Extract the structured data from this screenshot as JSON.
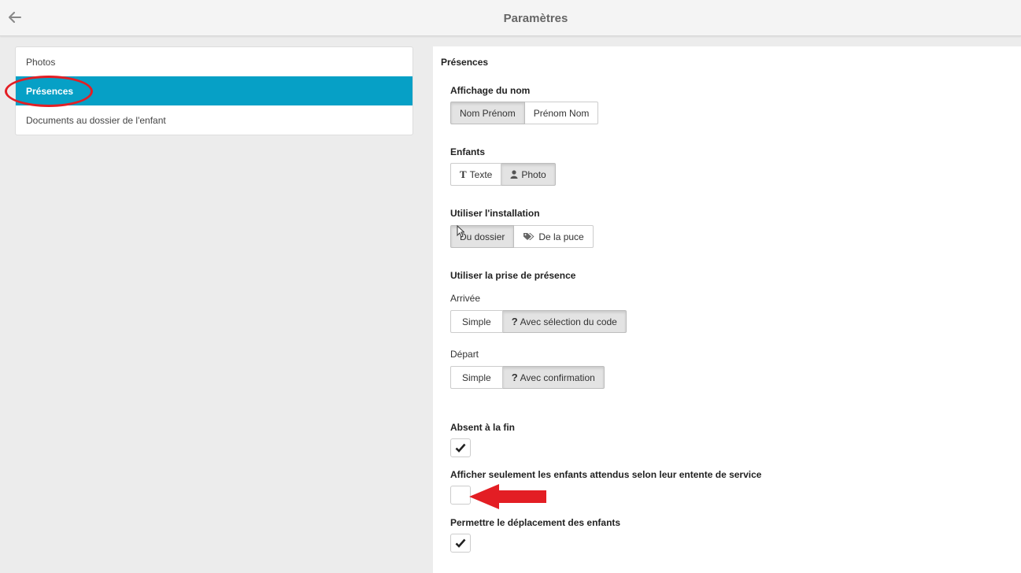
{
  "header": {
    "title": "Paramètres",
    "back_icon": "arrow-left-icon"
  },
  "sidebar": {
    "items": [
      {
        "label": "Photos",
        "active": false
      },
      {
        "label": "Présences",
        "active": true
      },
      {
        "label": "Documents au dossier de l'enfant",
        "active": false
      }
    ],
    "accent_color": "#06a0c6"
  },
  "main": {
    "section_title": "Présences",
    "name_display": {
      "label": "Affichage du nom",
      "options": [
        "Nom Prénom",
        "Prénom Nom"
      ],
      "selected": "Nom Prénom"
    },
    "children": {
      "label": "Enfants",
      "options": [
        {
          "label": "Texte",
          "icon": "text-icon",
          "icon_glyph": "T"
        },
        {
          "label": "Photo",
          "icon": "user-icon"
        }
      ],
      "selected": "Photo"
    },
    "installation": {
      "label": "Utiliser l'installation",
      "options": [
        {
          "label": "Du dossier"
        },
        {
          "label": "De la puce",
          "icon": "tags-icon"
        }
      ],
      "selected": "Du dossier"
    },
    "attendance": {
      "label": "Utiliser la prise de présence",
      "arrival": {
        "label": "Arrivée",
        "options": [
          {
            "label": "Simple"
          },
          {
            "label": "Avec sélection du code",
            "icon": "question-icon",
            "icon_glyph": "?"
          }
        ],
        "selected": "Avec sélection du code"
      },
      "departure": {
        "label": "Départ",
        "options": [
          {
            "label": "Simple"
          },
          {
            "label": "Avec confirmation",
            "icon": "question-icon",
            "icon_glyph": "?"
          }
        ],
        "selected": "Avec confirmation"
      }
    },
    "absent_at_end": {
      "label": "Absent à la fin",
      "checked": true
    },
    "show_expected_only": {
      "label": "Afficher seulement les enfants attendus selon leur entente de service",
      "checked": false
    },
    "allow_move": {
      "label": "Permettre le déplacement des enfants",
      "checked": true
    }
  },
  "annotations": {
    "highlight_color": "#e31e24"
  }
}
